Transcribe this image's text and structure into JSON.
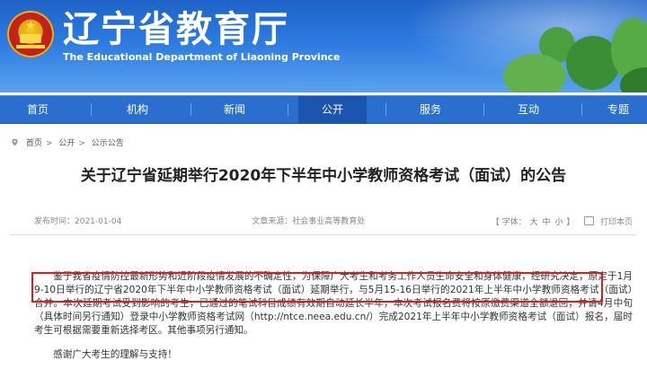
{
  "header": {
    "site_title": "辽宁省教育厅",
    "site_subtitle": "The Educational Department of Liaoning Province",
    "emblem_icon": "national-emblem-icon"
  },
  "nav": {
    "items": [
      {
        "label": "首页"
      },
      {
        "label": "机构"
      },
      {
        "label": "新闻"
      },
      {
        "label": "公开"
      },
      {
        "label": "服务"
      },
      {
        "label": "互动"
      },
      {
        "label": "专题"
      }
    ],
    "active_index": 3
  },
  "breadcrumb": {
    "icon": "location-pin-icon",
    "items": [
      "首页",
      "公开",
      "公示公告"
    ]
  },
  "article": {
    "title": "关于辽宁省延期举行2020年下半年中小学教师资格考试（面试）的公告",
    "publish_time": "发布时间：2021-01-04",
    "source": "文章来源：社会事业高等教育处",
    "font_size_label": "【 字体：",
    "font_sizes": [
      "大",
      "中",
      "小"
    ],
    "font_size_close": "】",
    "print_label": "打印本页",
    "paragraph1": "鉴于我省疫情防控最新形势和近阶段疫情发展的不确定性，为保障广大考生和考务工作人员生命安全和身体健康，经研究决定，原定于1月9-10日举行的辽宁省2020年下半年中小学教师资格考试（面试）延期举行，与5月15-16日举行的2021年上半年中小学教师资格考试（面试）合并。本次延期考试受到影响的考生，已通过的笔试科目成绩有效期自动延长半年，本次考试报名费将按原缴费渠道全额退回，并请4月中旬（具体时间另行通知）登录中小学教师资格考试网（http://ntce.neea.edu.cn/）完成2021年上半年中小学教师资格考试（面试）报名，届时考生可根据需要重新选择考区。其他事项另行通知。",
    "paragraph2": "感谢广大考生的理解与支持！"
  },
  "colors": {
    "nav_bg": "#2a6fcf",
    "highlight_border": "#e21b1b",
    "banner_blue": "#1f63c8"
  }
}
